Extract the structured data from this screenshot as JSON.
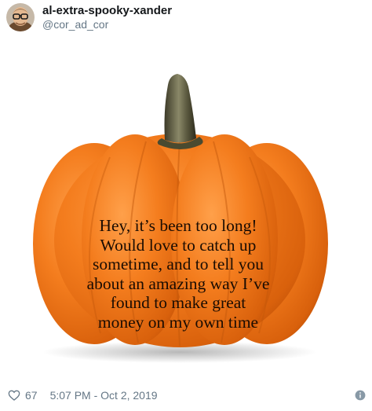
{
  "author": {
    "display_name": "al-extra-spooky-xander",
    "handle": "@cor_ad_cor"
  },
  "media": {
    "pumpkin_text_lines": [
      "Hey, it’s been too long!",
      "Would love to catch up",
      "sometime, and to tell you",
      "about an amazing way I’ve",
      "found to make great",
      "money on my own time"
    ]
  },
  "footer": {
    "likes": "67",
    "timestamp": "5:07 PM - Oct 2, 2019"
  },
  "icons": {
    "like": "heart-outline-icon",
    "info": "info-circle-icon"
  },
  "colors": {
    "pumpkin": "#f07a1a",
    "secondary_text": "#657786"
  }
}
